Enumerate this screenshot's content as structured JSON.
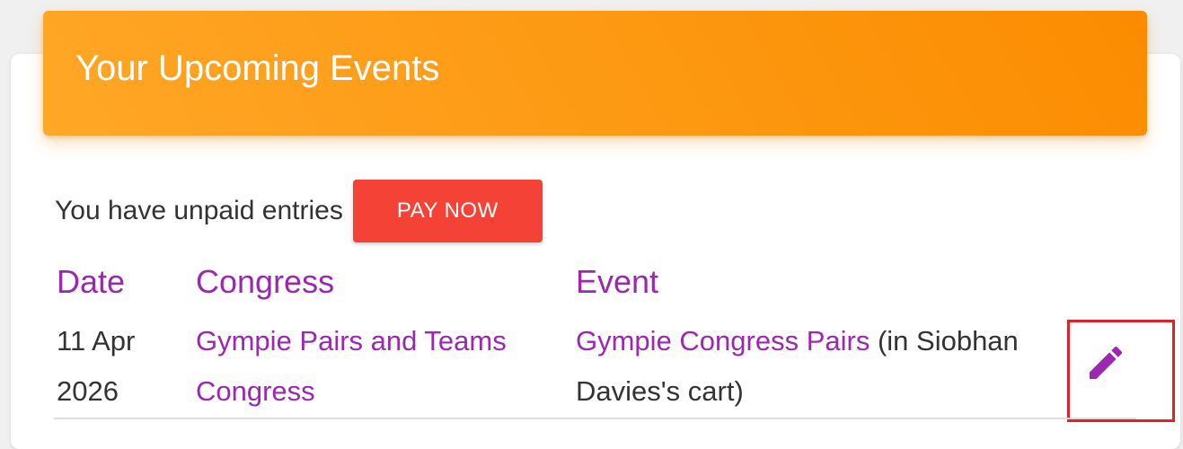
{
  "header": {
    "title": "Your Upcoming Events"
  },
  "unpaid": {
    "text": "You have unpaid entries",
    "pay_label": "PAY NOW"
  },
  "table": {
    "columns": [
      "Date",
      "Congress",
      "Event"
    ],
    "rows": [
      {
        "date_line1": "11 Apr",
        "date_line2": "2026",
        "congress_line1": "Gympie Pairs and Teams",
        "congress_line2": "Congress",
        "event_link": "Gympie Congress Pairs",
        "event_suffix_line1": " (in Siobhan",
        "event_suffix_line2": "Davies's cart)",
        "action_icon": "pencil-icon"
      }
    ]
  },
  "colors": {
    "header_start": "#ffa726",
    "header_end": "#fb8c00",
    "pay_button": "#f44336",
    "accent_purple": "#9c27b0",
    "highlight_red": "#e0202a"
  }
}
